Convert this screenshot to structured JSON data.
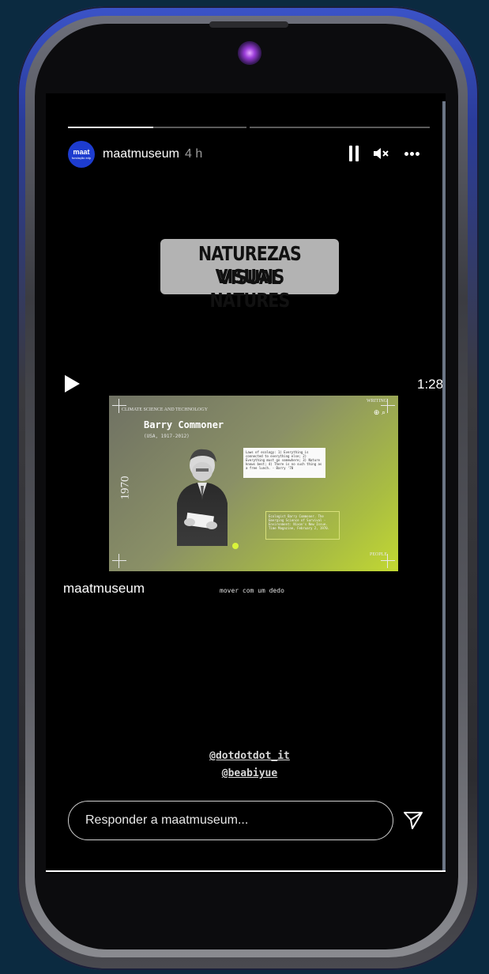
{
  "story": {
    "progress": [
      0.48,
      0.0
    ],
    "username": "maatmuseum",
    "time_ago": "4 h",
    "avatar_text": "maat",
    "avatar_subtext": "fundação edp",
    "title_line1": "NATUREZAS VISUAIS",
    "title_line2": "VISUAL NATURES",
    "video_duration": "1:28",
    "video": {
      "category": "CLIMATE SCIENCE AND TECHNOLOGY",
      "name": "Barry Commoner",
      "years": "(USA, 1917-2012)",
      "year_marker": "1970",
      "quote": "Laws of ecology: 1) Everything is connected to everything else; 2) Everything must go somewhere; 3) Nature knows best; 4) There is no such thing as a free lunch. - Barry '70",
      "caption": "Ecologist Barry Commoner. The Emerging Science of Survival - Environment: Nixon's New Issue. Time Magazine, February 2, 1970.",
      "corner_top": "WRITING",
      "corner_bottom": "PEOPLE"
    },
    "caption_user": "maatmuseum",
    "caption_hint": "mover com um dedo",
    "mentions": [
      "@dotdotdot_it",
      "@beabiyue"
    ],
    "reply_placeholder": "Responder a maatmuseum..."
  },
  "icons": {
    "pause": "pause-icon",
    "mute": "mute-icon",
    "more": "more-icon",
    "play": "play-icon",
    "send": "send-icon"
  },
  "colors": {
    "background": "#0b2a40",
    "screen": "#000000",
    "avatar": "#1d3ccf",
    "title_box": "#b3b3b3",
    "video_accent": "#c2d832"
  }
}
